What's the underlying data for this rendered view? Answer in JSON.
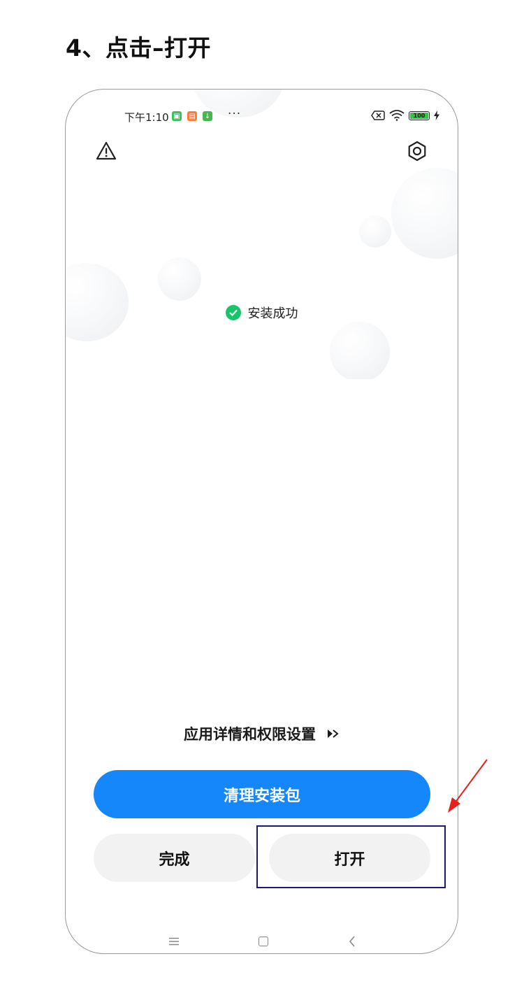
{
  "step_title": "4、点击–打开",
  "status_bar": {
    "time": "下午1:10",
    "more_dots": "···",
    "battery_level": "100"
  },
  "install": {
    "message": "安装成功"
  },
  "details_link": {
    "label": "应用详情和权限设置"
  },
  "buttons": {
    "clean": "清理安装包",
    "done": "完成",
    "open": "打开"
  },
  "colors": {
    "primary_button": "#1687fa",
    "success": "#17c46c",
    "highlight_border": "#1a1a6e",
    "arrow": "#e8201b"
  },
  "icons": {
    "top_left": "warning-triangle-icon",
    "top_right": "settings-hex-icon",
    "nav": [
      "menu-icon",
      "home-icon",
      "back-icon"
    ]
  }
}
